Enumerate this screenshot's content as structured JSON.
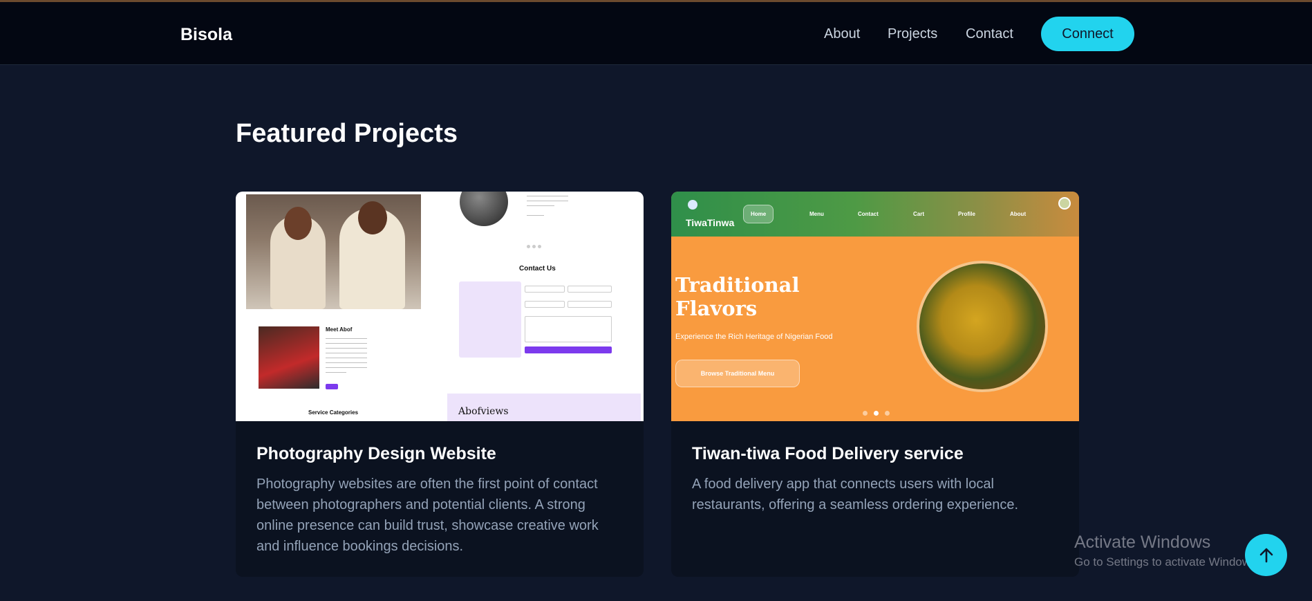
{
  "navbar": {
    "brand": "Bisola",
    "links": [
      "About",
      "Projects",
      "Contact"
    ],
    "connect_label": "Connect"
  },
  "section": {
    "title": "Featured Projects"
  },
  "projects": [
    {
      "title": "Photography Design Website",
      "description": "Photography websites are often the first point of contact between photographers and potential clients. A strong online presence can build trust, showcase creative work and influence bookings decisions.",
      "thumbnail": {
        "contact_heading": "Contact Us",
        "meet_heading": "Meet Abof",
        "service_heading": "Service Categories",
        "footer_logo": "Abofviews"
      }
    },
    {
      "title": "Tiwan-tiwa Food Delivery service",
      "description": "A food delivery app that connects users with local restaurants, offering a seamless ordering experience.",
      "thumbnail": {
        "logo": "TiwaTinwa",
        "nav_items": [
          "Home",
          "Menu",
          "Contact",
          "Cart",
          "Profile",
          "About"
        ],
        "hero_title": "Traditional Flavors",
        "hero_subtitle": "Experience the Rich Heritage of Nigerian Food",
        "hero_button": "Browse Traditional Menu"
      }
    }
  ],
  "watermark": {
    "title": "Activate Windows",
    "subtitle": "Go to Settings to activate Windows."
  },
  "colors": {
    "accent": "#22d3ee",
    "background": "#0f172a",
    "navbar": "#030712",
    "card": "#0b1220"
  },
  "icons": {
    "scroll_top": "arrow-up-icon"
  }
}
